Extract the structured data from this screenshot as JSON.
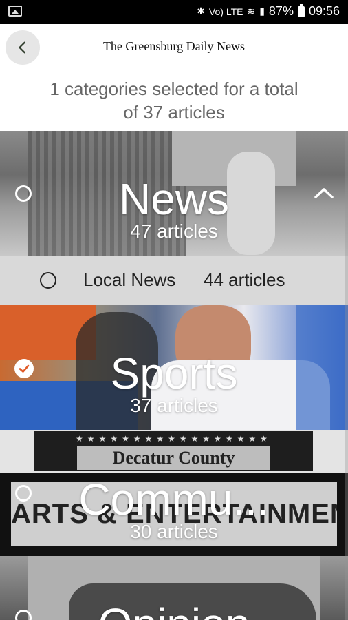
{
  "status_bar": {
    "battery": "87%",
    "time": "09:56",
    "network": "Vo) LTE"
  },
  "header": {
    "title": "The Greensburg Daily News"
  },
  "summary": {
    "line1": "1 categories selected for a total",
    "line2": "of 37 articles"
  },
  "categories": [
    {
      "title": "News",
      "count": "47 articles",
      "selected": false,
      "expanded": true,
      "subcategories": [
        {
          "label": "Local News",
          "count": "44 articles",
          "selected": false
        }
      ]
    },
    {
      "title": "Sports",
      "count": "37 articles",
      "selected": true
    },
    {
      "title": "Commu...",
      "count": "30 articles",
      "selected": false,
      "banner_text_top": "Decatur County",
      "banner_text_bottom": "ARTS & ENTERTAINMENT"
    },
    {
      "title": "Opinion",
      "count": "",
      "selected": false
    }
  ],
  "colors": {
    "appbar_bg": "#ffffff",
    "status_bg": "#000000",
    "subrow_bg": "#d9d9d9",
    "summary_text": "#666666"
  }
}
